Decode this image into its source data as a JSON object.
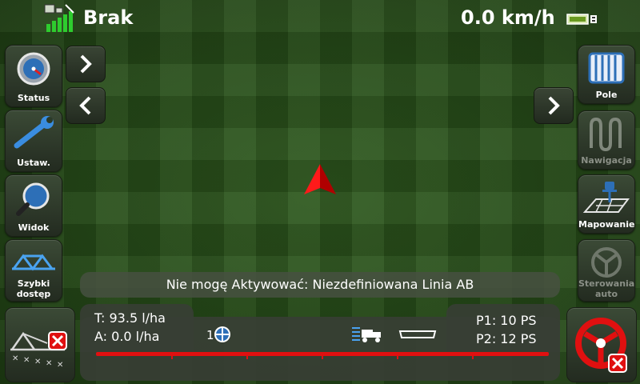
{
  "topbar": {
    "gps_status": "Brak",
    "speed": "0.0 km/h",
    "icons": {
      "gps": "gps-signal-icon",
      "battery": "battery-icon"
    }
  },
  "left_menu": [
    {
      "label": "Status",
      "icon": "gauge-icon"
    },
    {
      "label": "Ustaw.",
      "icon": "wrench-icon"
    },
    {
      "label": "Widok",
      "icon": "magnifier-icon"
    },
    {
      "label": "Szybki\ndostęp",
      "icon": "boom-icon"
    }
  ],
  "right_menu": [
    {
      "label": "Pole",
      "icon": "field-icon",
      "enabled": true
    },
    {
      "label": "Nawigacja",
      "icon": "navigation-icon",
      "enabled": false
    },
    {
      "label": "Mapowanie",
      "icon": "mapping-pin-icon",
      "enabled": true
    },
    {
      "label": "Sterowania\nauto",
      "icon": "autosteer-icon",
      "enabled": false
    }
  ],
  "message": "Nie mogę Aktywować: Niezdefiniowana Linia AB",
  "info": {
    "target_rate": "T: 93.5 l/ha",
    "applied_rate": "A: 0.0 l/ha",
    "section_number": "1",
    "p1": "P1:  10 PS",
    "p2": "P2:  12 PS"
  },
  "colors": {
    "accent_red": "#e01010",
    "background_green": "#2a5019"
  }
}
